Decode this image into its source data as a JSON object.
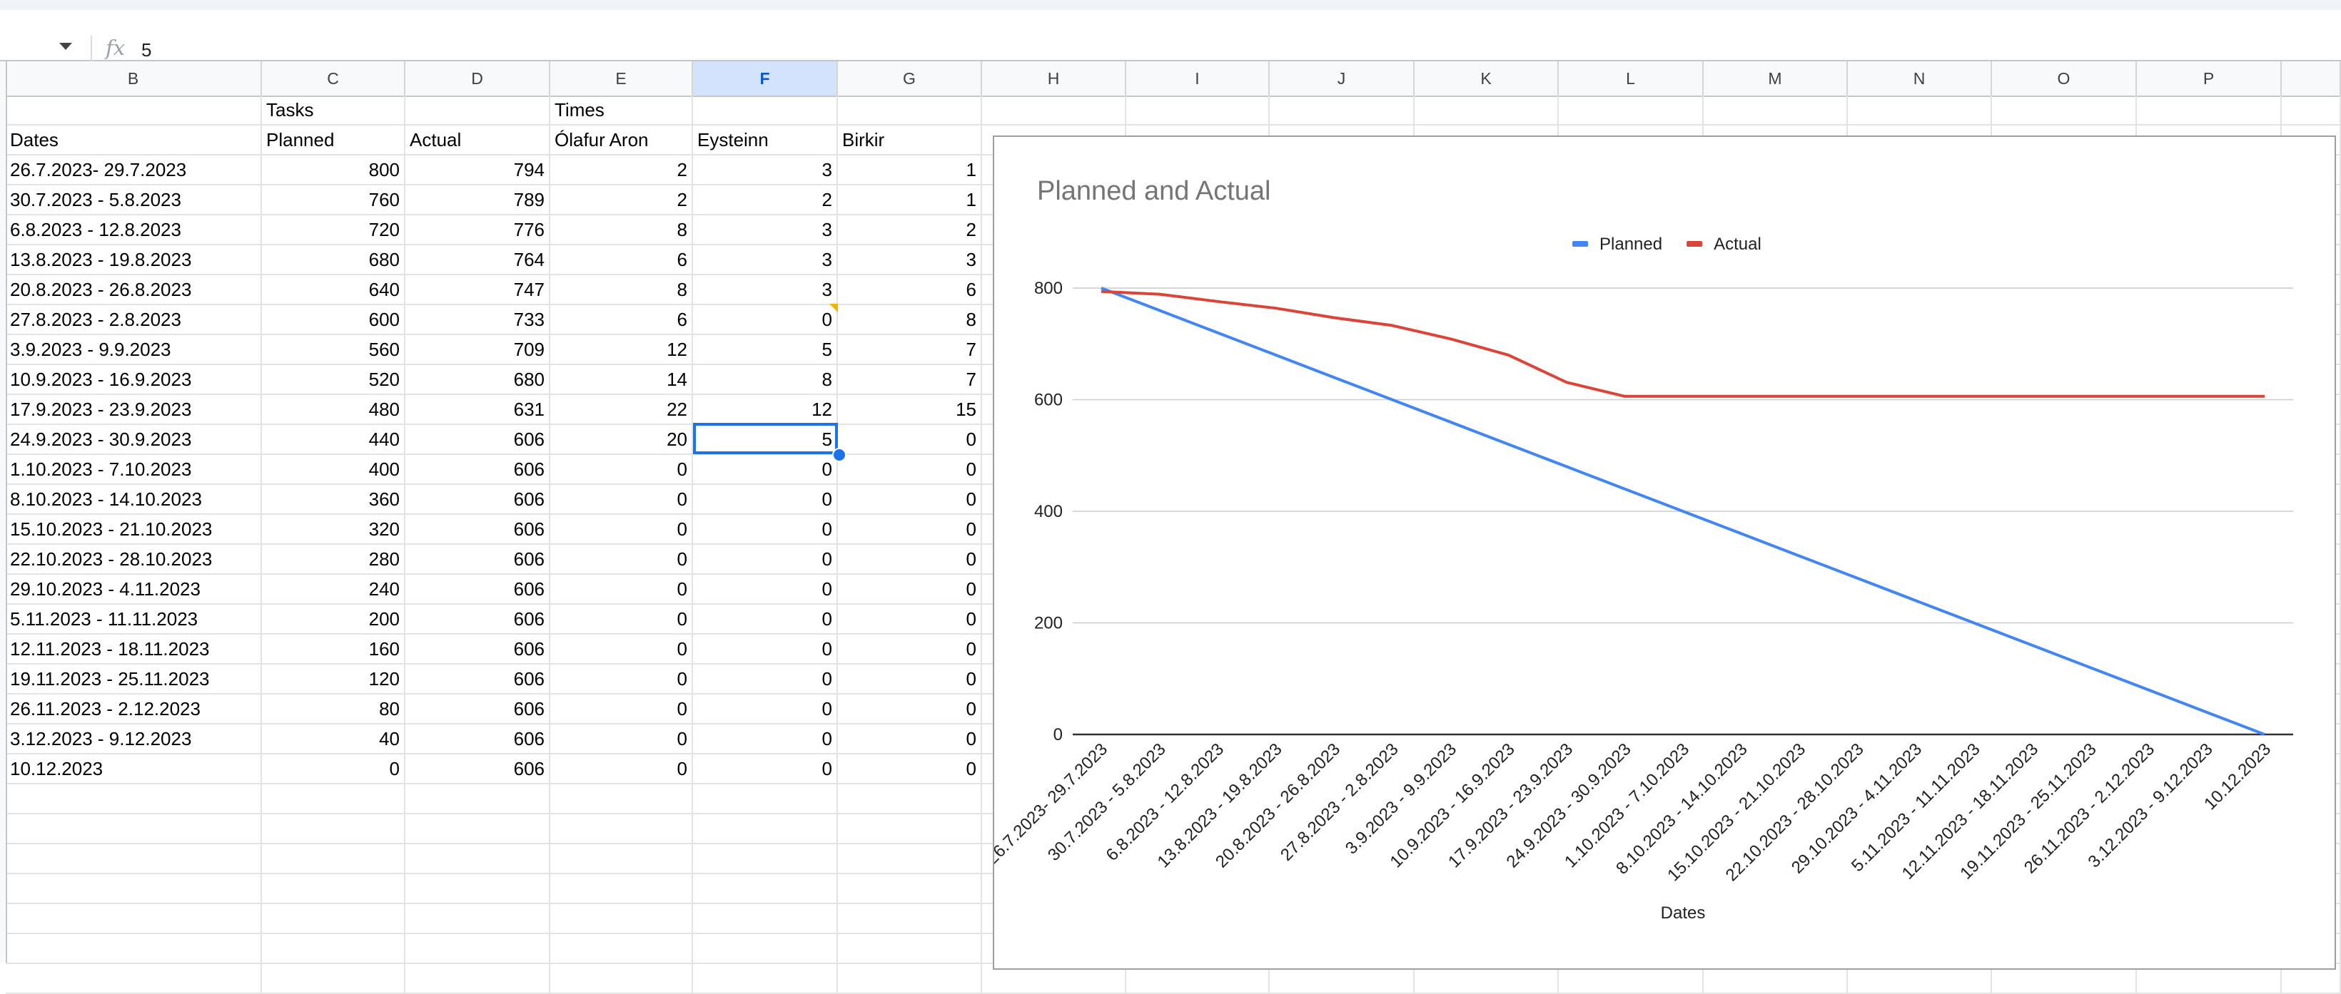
{
  "formula_bar": {
    "fx_symbol": "fx",
    "value": "5"
  },
  "columns": [
    {
      "id": "B",
      "label": "B",
      "selected": false
    },
    {
      "id": "C",
      "label": "C",
      "selected": false
    },
    {
      "id": "D",
      "label": "D",
      "selected": false
    },
    {
      "id": "E",
      "label": "E",
      "selected": false
    },
    {
      "id": "F",
      "label": "F",
      "selected": true
    },
    {
      "id": "G",
      "label": "G",
      "selected": false
    },
    {
      "id": "H",
      "label": "H",
      "selected": false
    },
    {
      "id": "I",
      "label": "I",
      "selected": false
    },
    {
      "id": "J",
      "label": "J",
      "selected": false
    },
    {
      "id": "K",
      "label": "K",
      "selected": false
    },
    {
      "id": "L",
      "label": "L",
      "selected": false
    },
    {
      "id": "M",
      "label": "M",
      "selected": false
    },
    {
      "id": "N",
      "label": "N",
      "selected": false
    },
    {
      "id": "O",
      "label": "O",
      "selected": false
    },
    {
      "id": "P",
      "label": "P",
      "selected": false
    }
  ],
  "sheet": {
    "group_headers": [
      "",
      "Tasks",
      "",
      "Times",
      "",
      ""
    ],
    "headers": [
      "Dates",
      "Planned",
      "Actual",
      "Ólafur Aron",
      "Eysteinn",
      "Birkir"
    ],
    "rows": [
      [
        "26.7.2023- 29.7.2023",
        "800",
        "794",
        "2",
        "3",
        "1"
      ],
      [
        "30.7.2023 - 5.8.2023",
        "760",
        "789",
        "2",
        "2",
        "1"
      ],
      [
        "6.8.2023 - 12.8.2023",
        "720",
        "776",
        "8",
        "3",
        "2"
      ],
      [
        "13.8.2023 - 19.8.2023",
        "680",
        "764",
        "6",
        "3",
        "3"
      ],
      [
        "20.8.2023 - 26.8.2023",
        "640",
        "747",
        "8",
        "3",
        "6"
      ],
      [
        "27.8.2023 - 2.8.2023",
        "600",
        "733",
        "6",
        "0",
        "8"
      ],
      [
        "3.9.2023 - 9.9.2023",
        "560",
        "709",
        "12",
        "5",
        "7"
      ],
      [
        "10.9.2023 - 16.9.2023",
        "520",
        "680",
        "14",
        "8",
        "7"
      ],
      [
        "17.9.2023 - 23.9.2023",
        "480",
        "631",
        "22",
        "12",
        "15"
      ],
      [
        "24.9.2023 - 30.9.2023",
        "440",
        "606",
        "20",
        "5",
        "0"
      ],
      [
        "1.10.2023 - 7.10.2023",
        "400",
        "606",
        "0",
        "0",
        "0"
      ],
      [
        "8.10.2023 - 14.10.2023",
        "360",
        "606",
        "0",
        "0",
        "0"
      ],
      [
        "15.10.2023 - 21.10.2023",
        "320",
        "606",
        "0",
        "0",
        "0"
      ],
      [
        "22.10.2023 - 28.10.2023",
        "280",
        "606",
        "0",
        "0",
        "0"
      ],
      [
        "29.10.2023 - 4.11.2023",
        "240",
        "606",
        "0",
        "0",
        "0"
      ],
      [
        "5.11.2023 - 11.11.2023",
        "200",
        "606",
        "0",
        "0",
        "0"
      ],
      [
        "12.11.2023 - 18.11.2023",
        "160",
        "606",
        "0",
        "0",
        "0"
      ],
      [
        "19.11.2023 - 25.11.2023",
        "120",
        "606",
        "0",
        "0",
        "0"
      ],
      [
        "26.11.2023 - 2.12.2023",
        "80",
        "606",
        "0",
        "0",
        "0"
      ],
      [
        "3.12.2023 - 9.12.2023",
        "40",
        "606",
        "0",
        "0",
        "0"
      ],
      [
        "10.12.2023",
        "0",
        "606",
        "0",
        "0",
        "0"
      ]
    ],
    "selected_cell": {
      "column": "F",
      "value": "5"
    }
  },
  "chart_data": {
    "type": "line",
    "title": "Planned and Actual",
    "xlabel": "Dates",
    "ylabel": "",
    "ylim": [
      0,
      800
    ],
    "yticks": [
      0,
      200,
      400,
      600,
      800
    ],
    "grid": true,
    "legend_position": "top",
    "categories": [
      "26.7.2023- 29.7.2023",
      "30.7.2023 - 5.8.2023",
      "6.8.2023 - 12.8.2023",
      "13.8.2023 - 19.8.2023",
      "20.8.2023 - 26.8.2023",
      "27.8.2023 - 2.8.2023",
      "3.9.2023 - 9.9.2023",
      "10.9.2023 - 16.9.2023",
      "17.9.2023 - 23.9.2023",
      "24.9.2023 - 30.9.2023",
      "1.10.2023 - 7.10.2023",
      "8.10.2023 - 14.10.2023",
      "15.10.2023 - 21.10.2023",
      "22.10.2023 - 28.10.2023",
      "29.10.2023 - 4.11.2023",
      "5.11.2023 - 11.11.2023",
      "12.11.2023 - 18.11.2023",
      "19.11.2023 - 25.11.2023",
      "26.11.2023 - 2.12.2023",
      "3.12.2023 - 9.12.2023",
      "10.12.2023"
    ],
    "series": [
      {
        "name": "Planned",
        "color": "#4285f4",
        "values": [
          800,
          760,
          720,
          680,
          640,
          600,
          560,
          520,
          480,
          440,
          400,
          360,
          320,
          280,
          240,
          200,
          160,
          120,
          80,
          40,
          0
        ]
      },
      {
        "name": "Actual",
        "color": "#db4437",
        "values": [
          794,
          789,
          776,
          764,
          747,
          733,
          709,
          680,
          631,
          606,
          606,
          606,
          606,
          606,
          606,
          606,
          606,
          606,
          606,
          606,
          606
        ]
      }
    ]
  }
}
